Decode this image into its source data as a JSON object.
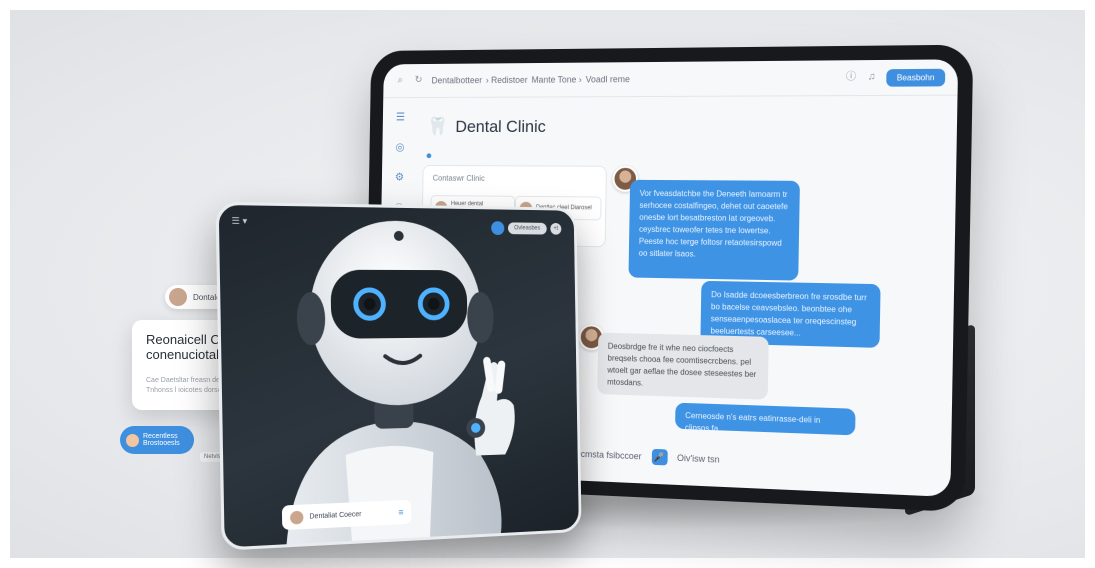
{
  "tablet": {
    "breadcrumb": [
      "Dentalbotteer",
      "› Redistoer",
      "Mante Tone ›",
      "Voadl reme"
    ],
    "top_button": "Beasbohn",
    "clinic_title": "Dental Clinic",
    "contacts_panel": {
      "title": "Contaswr Clinic",
      "cards": [
        {
          "label": "Heuer dental Dentatefoofed"
        },
        {
          "label": "Dentlec cleel Diarosel"
        }
      ]
    },
    "messages": [
      {
        "side": "incoming-blue",
        "text": "Vor fveasdatchbe the Deneeth lamoarm tr serhocee costalfingeo, dehet out caoetefe onesbe lort besatbreston lat orgeoveb. ceysbrec toweofer tetes tne lowertse.  Peeste hoc terge foltosr retaotesirspowd oo sitlater lsaos."
      },
      {
        "side": "outgoing-blue",
        "text": "Do Isadde dcoeesberbreon fre srosdbe turr bo bacelse ceavsebsleo. beonbtee ohe senseaenpesoaslacea ter oreqescinsteg beeluertests carseesee..."
      },
      {
        "side": "incoming-gray",
        "text": "Deosbrdge fre it whe neo ciocfoects breqsels chooa fee coomtisecrcbens. pel wtoelt gar aeflae the dosee steseestes ber mtosdans."
      },
      {
        "side": "outgoing-blue",
        "text": "Cerneosde n's eatrs eatinrasse-deli in clipsos fa"
      }
    ],
    "composer": {
      "close_symbol": "×",
      "placeholder": "Decmsta fsibccoer",
      "send_label": "Oiv'isw tsn"
    }
  },
  "left_cards": {
    "name_pill": "Dontalc tbagem",
    "text_card": {
      "heading": "Reonaicell Cersione A l cloerrnier conenuciotal neplungrods:",
      "body": "Cae Daetsltar freasn desesweltar poodecea Cebenostarstes Tnhonss l ioicotes dorsoesn"
    },
    "blue_pill": "Recentless Brostooesls",
    "caption": "Netvlsoncleterdinetiasetoalsn"
  },
  "robot_card": {
    "top_chip": "Ovleasbes",
    "small_chip": "+t",
    "bottom_label": "Dentaliat Coecer"
  },
  "colors": {
    "accent_blue": "#3f8fe0",
    "bubble_blue": "#3e93e5",
    "bubble_gray": "#e4e6e9",
    "tablet_frame": "#17191c",
    "robot_bg": "#1f262d"
  },
  "icons": [
    "tooth-icon",
    "search-icon",
    "bell-icon",
    "mic-icon",
    "menu-icon"
  ]
}
